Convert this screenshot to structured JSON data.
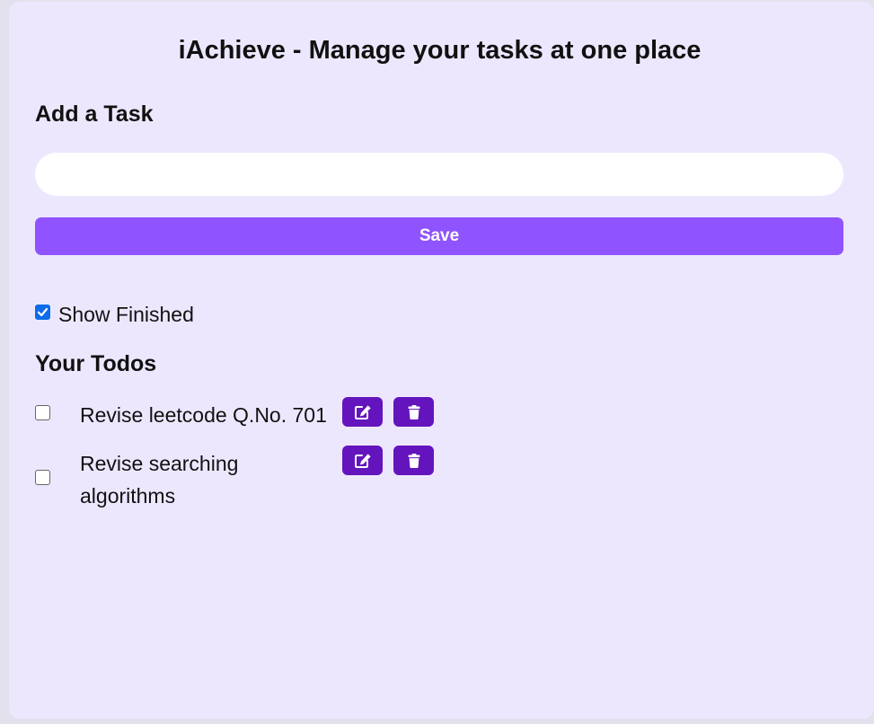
{
  "app": {
    "title": "iAchieve - Manage your tasks at one place"
  },
  "add_task": {
    "heading": "Add a Task",
    "input_value": "",
    "save_label": "Save"
  },
  "filter": {
    "show_finished_label": "Show Finished",
    "show_finished_checked": true
  },
  "todos": {
    "heading": "Your Todos",
    "items": [
      {
        "text": "Revise leetcode Q.No. 701",
        "done": false,
        "edit_icon": "edit-icon",
        "delete_icon": "trash-icon"
      },
      {
        "text": "Revise searching algorithms",
        "done": false,
        "edit_icon": "edit-icon",
        "delete_icon": "trash-icon"
      }
    ]
  },
  "colors": {
    "page_bg": "#e4e1ee",
    "card_bg": "#ede7fe",
    "save_button": "#8f53ff",
    "icon_button": "#6414bd",
    "checkbox_checked": "#0f6bec"
  }
}
